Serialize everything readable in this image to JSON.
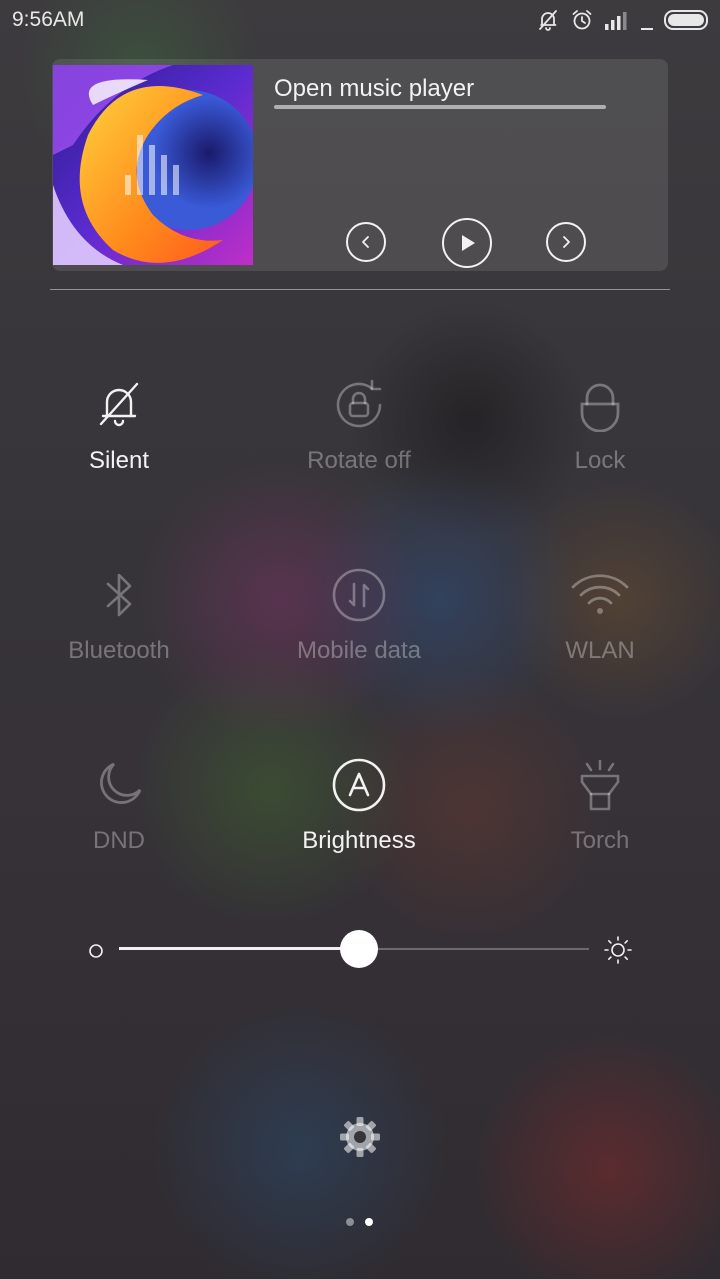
{
  "status_bar": {
    "time": "9:56AM",
    "icons": [
      "bell-off-icon",
      "alarm-icon",
      "signal-icon",
      "battery-icon"
    ]
  },
  "music": {
    "title": "Open music player",
    "controls": [
      "previous-icon",
      "play-icon",
      "next-icon"
    ]
  },
  "toggles": [
    {
      "label": "Silent",
      "icon": "bell-off-icon",
      "active": true
    },
    {
      "label": "Rotate off",
      "icon": "rotate-lock-icon",
      "active": false
    },
    {
      "label": "Lock",
      "icon": "lock-icon",
      "active": false
    },
    {
      "label": "Bluetooth",
      "icon": "bluetooth-icon",
      "active": false
    },
    {
      "label": "Mobile data",
      "icon": "mobile-data-icon",
      "active": false
    },
    {
      "label": "WLAN",
      "icon": "wifi-icon",
      "active": false
    },
    {
      "label": "DND",
      "icon": "moon-icon",
      "active": false
    },
    {
      "label": "Brightness",
      "icon": "auto-brightness-icon",
      "active": true
    },
    {
      "label": "Torch",
      "icon": "flashlight-icon",
      "active": false
    }
  ],
  "brightness": {
    "level": 0.51
  },
  "pager": {
    "pages": 2,
    "current": 2
  },
  "colors": {
    "active": "#f2f2f2",
    "inactive": "rgba(255,255,255,0.32)"
  }
}
